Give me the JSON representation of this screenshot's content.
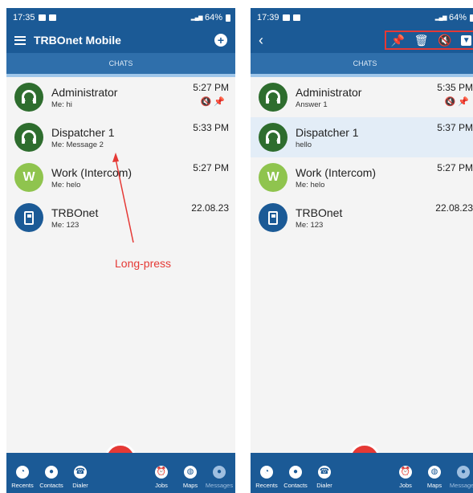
{
  "left": {
    "status": {
      "time": "17:35",
      "battery": "64%"
    },
    "app_title": "TRBOnet Mobile",
    "tab": "CHATS",
    "chats": [
      {
        "name": "Administrator",
        "msg": "Me: hi",
        "time": "5:27 PM"
      },
      {
        "name": "Dispatcher 1",
        "msg": "Me: Message 2",
        "time": "5:33 PM"
      },
      {
        "name": "Work (Intercom)",
        "msg": "Me: helo",
        "time": "5:27 PM",
        "avatar_letter": "W"
      },
      {
        "name": "TRBOnet",
        "msg": "Me: 123",
        "time": "22.08.23"
      }
    ],
    "annotation": "Long-press"
  },
  "right": {
    "status": {
      "time": "17:39",
      "battery": "64%"
    },
    "tab": "CHATS",
    "chats": [
      {
        "name": "Administrator",
        "msg": "Answer 1",
        "time": "5:35 PM"
      },
      {
        "name": "Dispatcher 1",
        "msg": "hello",
        "time": "5:37 PM"
      },
      {
        "name": "Work (Intercom)",
        "msg": "Me: helo",
        "time": "5:27 PM",
        "avatar_letter": "W"
      },
      {
        "name": "TRBOnet",
        "msg": "Me: 123",
        "time": "22.08.23"
      }
    ]
  },
  "nav": {
    "recents": "Recents",
    "contacts": "Contacts",
    "dialer": "Dialer",
    "jobs": "Jobs",
    "maps": "Maps",
    "messages": "Messages"
  },
  "colors": {
    "primary": "#1b5a96",
    "accent": "#e53935",
    "tab": "#2f6fab",
    "selected": "#e3edf7"
  }
}
